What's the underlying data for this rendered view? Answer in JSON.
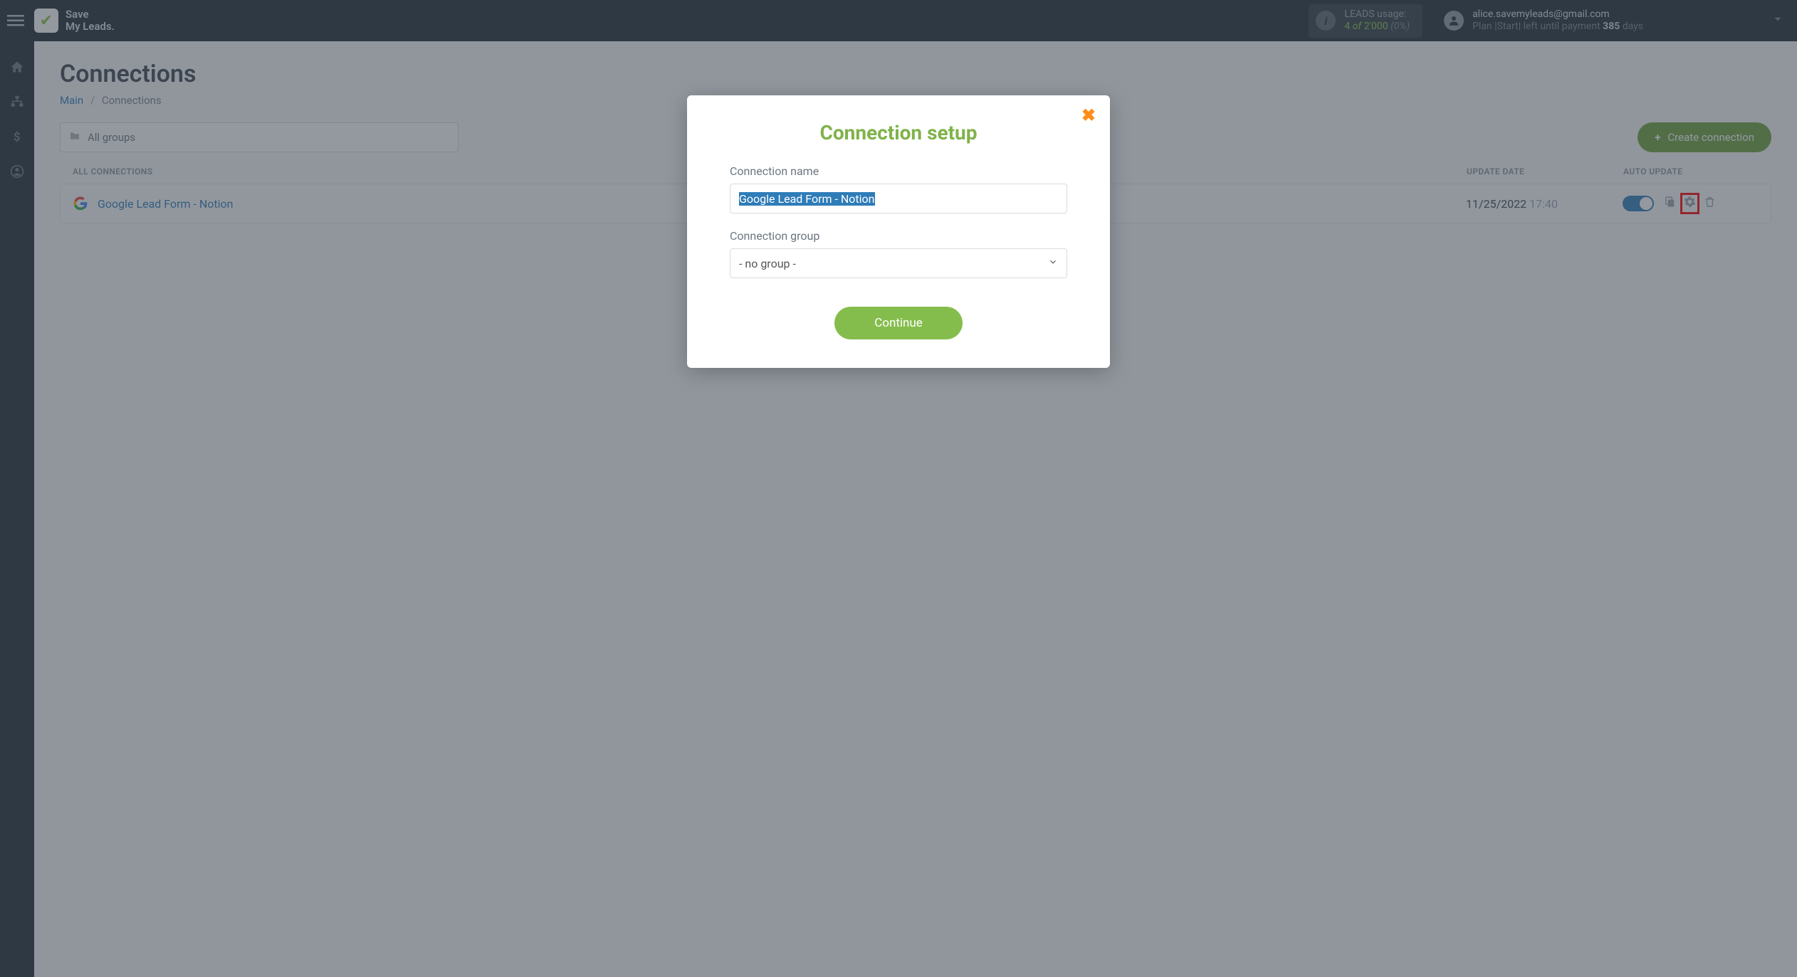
{
  "brand": {
    "line1": "Save",
    "line2": "My Leads."
  },
  "usage": {
    "label": "LEADS usage:",
    "used": "4",
    "of": "of",
    "total": "2'000",
    "pct": "(0%)"
  },
  "user": {
    "email": "alice.savemyleads@gmail.com",
    "plan_prefix": "Plan |Start| left until payment ",
    "plan_days": "385",
    "plan_suffix": " days"
  },
  "page": {
    "title": "Connections"
  },
  "breadcrumb": {
    "main": "Main",
    "sep": "/",
    "current": "Connections"
  },
  "group_select": "All groups",
  "create_button": "Create connection",
  "table": {
    "headers": {
      "name": "ALL CONNECTIONS",
      "date": "UPDATE DATE",
      "auto": "AUTO UPDATE"
    },
    "row": {
      "name": "Google Lead Form - Notion",
      "date": "11/25/2022",
      "time": "17:40"
    }
  },
  "modal": {
    "title": "Connection setup",
    "name_label": "Connection name",
    "name_value": "Google Lead Form - Notion",
    "group_label": "Connection group",
    "group_value": "- no group -",
    "continue": "Continue"
  }
}
